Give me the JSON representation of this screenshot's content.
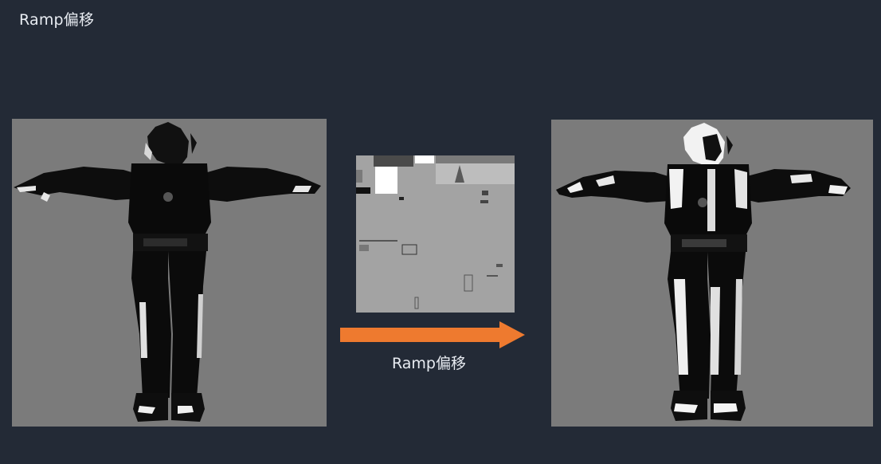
{
  "slide": {
    "title": "Ramp偏移"
  },
  "diagram": {
    "arrow_label": "Ramp偏移",
    "arrow_color": "#ee7a2f",
    "background_color": "#232a36",
    "panels": {
      "before": {
        "content": "character-silhouette-dark-shading"
      },
      "ramp": {
        "content": "ramp-texture-map"
      },
      "after": {
        "content": "character-silhouette-offset-shading"
      }
    }
  }
}
